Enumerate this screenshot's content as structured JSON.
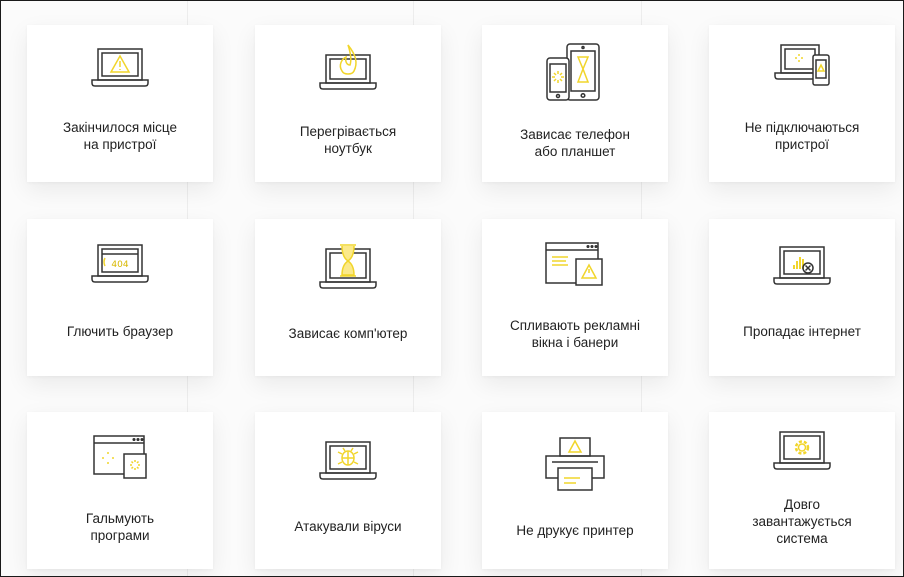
{
  "accent_color": "#f1d52b",
  "line_color": "#333333",
  "services": [
    {
      "label": "Закінчилося місце\nна пристрої",
      "icon": "laptop-warning-icon"
    },
    {
      "label": "Перегрівається\nноутбук",
      "icon": "laptop-flame-icon"
    },
    {
      "label": "Зависає телефон\nабо планшет",
      "icon": "phone-tablet-hourglass-icon"
    },
    {
      "label": "Не підключаються\nпристрої",
      "icon": "devices-connect-icon"
    },
    {
      "label": "Глючить браузер",
      "icon": "browser-404-icon"
    },
    {
      "label": "Зависає комп'ютер",
      "icon": "laptop-hourglass-icon"
    },
    {
      "label": "Спливають рекламні\nвікна і банери",
      "icon": "popup-ads-icon"
    },
    {
      "label": "Пропадає інтернет",
      "icon": "laptop-no-internet-icon"
    },
    {
      "label": "Гальмують\nпрограми",
      "icon": "windows-loading-icon"
    },
    {
      "label": "Атакували віруси",
      "icon": "laptop-bug-icon"
    },
    {
      "label": "Не друкує принтер",
      "icon": "printer-warning-icon"
    },
    {
      "label": "Довго\nзавантажується\nсистема",
      "icon": "laptop-gear-icon"
    }
  ]
}
